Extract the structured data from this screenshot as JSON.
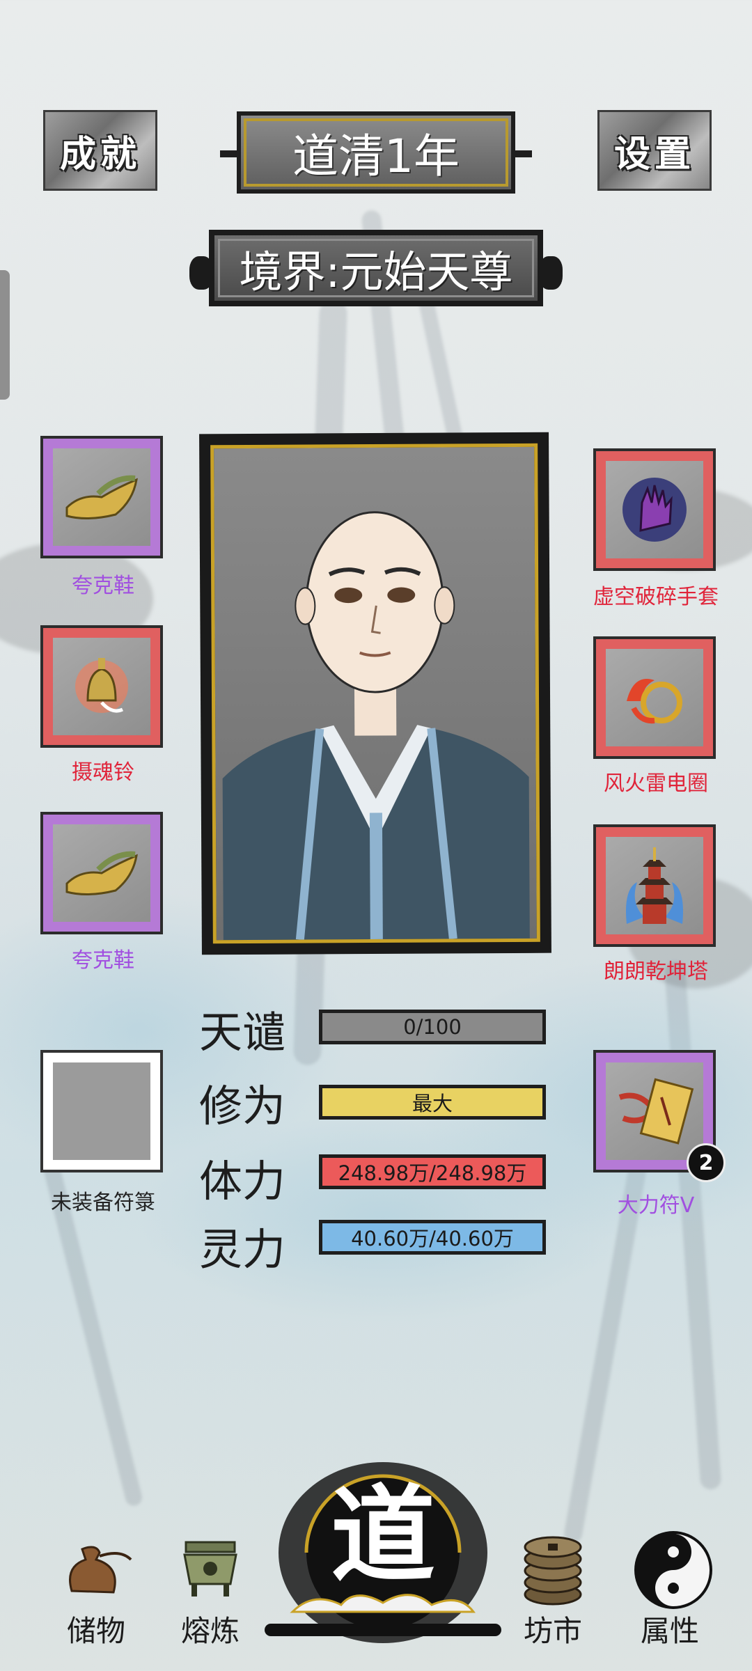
{
  "header": {
    "achievements_label": "成就",
    "year_label": "道清1年",
    "settings_label": "设置",
    "realm_label": "境界:元始天尊"
  },
  "equipment": {
    "left": [
      {
        "name": "夸克鞋",
        "rarity": "purple",
        "icon": "shoe-icon"
      },
      {
        "name": "摄魂铃",
        "rarity": "red",
        "icon": "bell-icon"
      },
      {
        "name": "夸克鞋",
        "rarity": "purple",
        "icon": "shoe-icon"
      }
    ],
    "right": [
      {
        "name": "虚空破碎手套",
        "rarity": "red",
        "icon": "glove-icon"
      },
      {
        "name": "风火雷电圈",
        "rarity": "red",
        "icon": "fire-ring-icon"
      },
      {
        "name": "朗朗乾坤塔",
        "rarity": "red",
        "icon": "pagoda-icon"
      }
    ],
    "talisman_empty_label": "未装备符箓",
    "talisman": {
      "name": "大力符V",
      "count": "2",
      "rarity": "purple",
      "icon": "talisman-icon"
    }
  },
  "stats": [
    {
      "label": "天谴",
      "value": "0/100",
      "color": "#8a8a8a",
      "fill": 0
    },
    {
      "label": "修为",
      "value": "最大",
      "color": "#e8d262",
      "fill": 1
    },
    {
      "label": "体力",
      "value": "248.98万/248.98万",
      "color": "#ec5a5a",
      "fill": 1
    },
    {
      "label": "灵力",
      "value": "40.60万/40.60万",
      "color": "#7db9e6",
      "fill": 1
    }
  ],
  "nav": {
    "storage": "储物",
    "smelting": "熔炼",
    "dao": "道",
    "market": "坊市",
    "attributes": "属性"
  },
  "colors": {
    "purple_rarity": "#b57ad6",
    "red_rarity": "#e06060",
    "purple_text": "#a14fe0",
    "red_text": "#e0243a",
    "gold_frame": "#c9a227"
  }
}
